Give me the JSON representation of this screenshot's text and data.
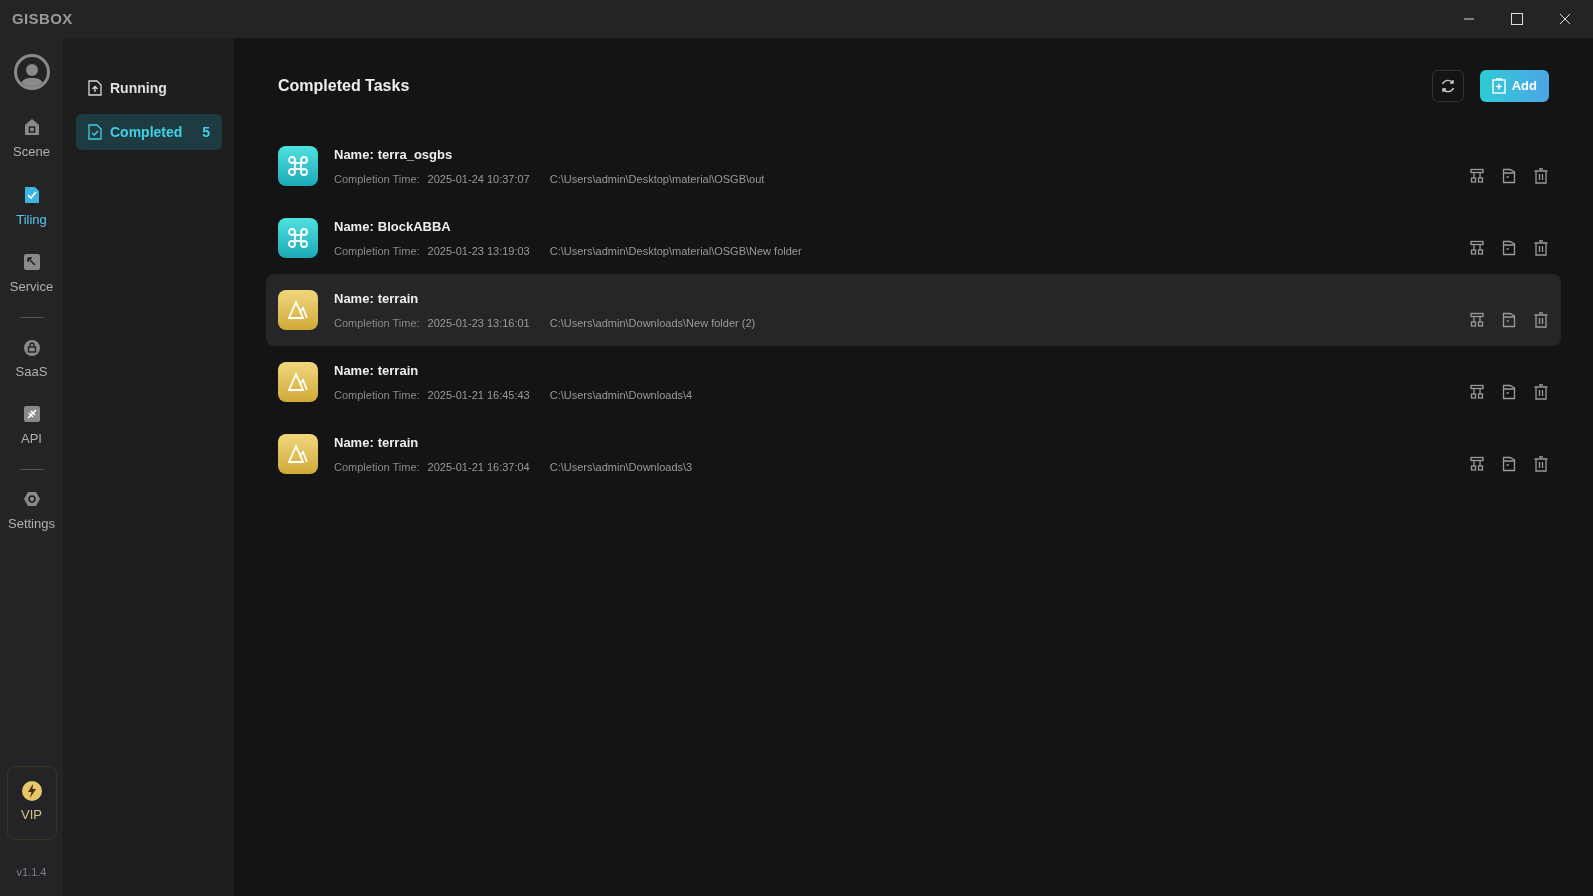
{
  "window": {
    "logo": "GISBOX"
  },
  "nav_groups": [
    [
      {
        "label": "Scene",
        "kind": "scene",
        "selected": false
      },
      {
        "label": "Tiling",
        "kind": "tiling",
        "selected": true
      },
      {
        "label": "Service",
        "kind": "service",
        "selected": false
      }
    ],
    [
      {
        "label": "SaaS",
        "kind": "saas",
        "selected": false
      },
      {
        "label": "API",
        "kind": "api",
        "selected": false
      }
    ],
    [
      {
        "label": "Settings",
        "kind": "settings",
        "selected": false
      }
    ]
  ],
  "vip": {
    "label": "VIP"
  },
  "version": "v1.1.4",
  "submenu": [
    {
      "label": "Running",
      "kind": "running",
      "selected": false
    },
    {
      "label": "Completed",
      "kind": "completed",
      "selected": true,
      "count": "5"
    }
  ],
  "main": {
    "title": "Completed Tasks",
    "add_button": "Add"
  },
  "tasks": [
    {
      "kind": "model",
      "name_label": "Name:",
      "name": "terra_osgbs",
      "time_label": "Completion Time:",
      "time": "2025-01-24 10:37:07",
      "path": "C:\\Users\\admin\\Desktop\\material\\OSGB\\out",
      "highlighted": false
    },
    {
      "kind": "model",
      "name_label": "Name:",
      "name": "BlockABBA",
      "time_label": "Completion Time:",
      "time": "2025-01-23 13:19:03",
      "path": "C:\\Users\\admin\\Desktop\\material\\OSGB\\New folder",
      "highlighted": false
    },
    {
      "kind": "terrain",
      "name_label": "Name:",
      "name": "terrain",
      "time_label": "Completion Time:",
      "time": "2025-01-23 13:16:01",
      "path": "C:\\Users\\admin\\Downloads\\New folder (2)",
      "highlighted": true
    },
    {
      "kind": "terrain",
      "name_label": "Name:",
      "name": "terrain",
      "time_label": "Completion Time:",
      "time": "2025-01-21 16:45:43",
      "path": "C:\\Users\\admin\\Downloads\\4",
      "highlighted": false
    },
    {
      "kind": "terrain",
      "name_label": "Name:",
      "name": "terrain",
      "time_label": "Completion Time:",
      "time": "2025-01-21 16:37:04",
      "path": "C:\\Users\\admin\\Downloads\\3",
      "highlighted": false
    }
  ]
}
